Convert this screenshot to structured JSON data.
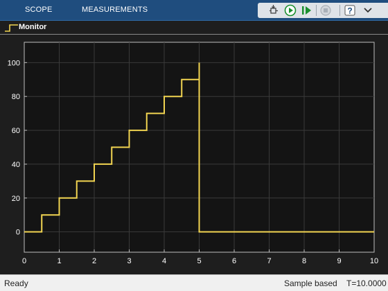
{
  "toolstrip": {
    "tabs": [
      {
        "label": "SCOPE"
      },
      {
        "label": "MEASUREMENTS"
      }
    ],
    "quick_access": [
      {
        "icon": "highlight-block-icon"
      },
      {
        "icon": "run-icon"
      },
      {
        "icon": "step-forward-icon"
      },
      {
        "icon": "stop-icon"
      },
      {
        "icon": "help-icon"
      },
      {
        "icon": "expand-menu-icon"
      }
    ]
  },
  "legend": {
    "label": "Monitor",
    "color": "#f2d551"
  },
  "colors": {
    "plot_background": "#141414",
    "grid": "#3a3a3a",
    "axis_text": "#ffffff",
    "signal": "#f2d551",
    "toolstrip": "#1f4d7e"
  },
  "chart_data": {
    "type": "line",
    "title": "",
    "xlabel": "",
    "ylabel": "",
    "xlim": [
      0,
      10
    ],
    "ylim": [
      -12,
      112
    ],
    "x_ticks": [
      "0",
      "1",
      "2",
      "3",
      "4",
      "5",
      "6",
      "7",
      "8",
      "9",
      "10"
    ],
    "y_ticks": [
      "0",
      "20",
      "40",
      "60",
      "80",
      "100"
    ],
    "grid": true,
    "series": [
      {
        "name": "Monitor",
        "step": true,
        "x": [
          0,
          0.5,
          1,
          1.5,
          2,
          2.5,
          3,
          3.5,
          4,
          4.5,
          5,
          5,
          10
        ],
        "y": [
          0,
          10,
          20,
          30,
          40,
          50,
          60,
          70,
          80,
          90,
          100,
          0,
          0
        ]
      }
    ]
  },
  "status": {
    "left": "Ready",
    "mode": "Sample based",
    "time": "T=10.0000"
  }
}
